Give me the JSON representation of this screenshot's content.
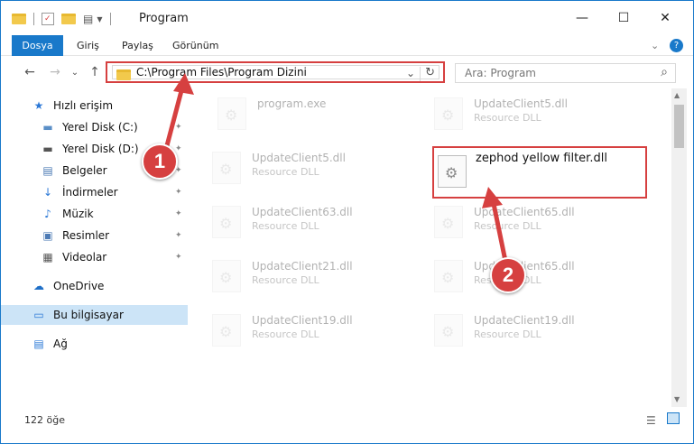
{
  "window": {
    "title": "Program",
    "controls": {
      "minimize": "—",
      "maximize": "☐",
      "close": "✕"
    }
  },
  "ribbon": {
    "tabs": [
      {
        "label": "Dosya"
      },
      {
        "label": "Giriş"
      },
      {
        "label": "Paylaş"
      },
      {
        "label": "Görünüm"
      }
    ],
    "expand_glyph": "⌄",
    "help_glyph": "?"
  },
  "navbar": {
    "back_glyph": "←",
    "forward_glyph": "→",
    "recent_glyph": "⌄",
    "up_glyph": "↑",
    "address": "C:\\Program Files\\Program Dizini",
    "dropdown_glyph": "⌄",
    "refresh_glyph": "↻",
    "search_placeholder": "Ara: Program",
    "search_glyph": "⌕"
  },
  "sidebar": {
    "items": [
      {
        "label": "Hızlı erişim",
        "icon": "star-icon",
        "glyph": "★",
        "color": "#2b78d6"
      },
      {
        "label": "Yerel Disk (C:)",
        "icon": "drive-icon",
        "glyph": "▬",
        "color": "#5a8fc7",
        "pinned": true
      },
      {
        "label": "Yerel Disk (D:)",
        "icon": "drive-icon",
        "glyph": "▬",
        "color": "#555555",
        "pinned": true
      },
      {
        "label": "Belgeler",
        "icon": "document-icon",
        "glyph": "▤",
        "color": "#4d7bb5",
        "pinned": true
      },
      {
        "label": "İndirmeler",
        "icon": "download-icon",
        "glyph": "↓",
        "color": "#2b78d6",
        "pinned": true
      },
      {
        "label": "Müzik",
        "icon": "music-icon",
        "glyph": "♪",
        "color": "#2b78d6",
        "pinned": true
      },
      {
        "label": "Resimler",
        "icon": "pictures-icon",
        "glyph": "▣",
        "color": "#4d7bb5",
        "pinned": true
      },
      {
        "label": "Videolar",
        "icon": "video-icon",
        "glyph": "▦",
        "color": "#555555",
        "pinned": true
      },
      {
        "label": "OneDrive",
        "icon": "cloud-icon",
        "glyph": "☁",
        "color": "#1f6fc7"
      },
      {
        "label": "Bu bilgisayar",
        "icon": "computer-icon",
        "glyph": "▭",
        "color": "#2b78d6",
        "selected": true
      },
      {
        "label": "Ağ",
        "icon": "network-icon",
        "glyph": "▤",
        "color": "#2b78d6"
      }
    ],
    "pin_glyph": "📌"
  },
  "files": [
    {
      "name": "program.exe",
      "desc": "",
      "faded": true
    },
    {
      "name": "UpdateClient5.dll",
      "desc": "Resource DLL",
      "faded": true
    },
    {
      "name": "UpdateClient5.dll",
      "desc": "Resource DLL",
      "faded": true
    },
    {
      "name": "zephod yellow filter.dll",
      "desc": "",
      "faded": false,
      "highlighted": true
    },
    {
      "name": "UpdateClient63.dll",
      "desc": "Resource DLL",
      "faded": true
    },
    {
      "name": "UpdateClient65.dll",
      "desc": "Resource DLL",
      "faded": true
    },
    {
      "name": "UpdateClient21.dll",
      "desc": "Resource DLL",
      "faded": true
    },
    {
      "name": "UpdateClient65.dll",
      "desc": "Resource DLL",
      "faded": true
    },
    {
      "name": "UpdateClient19.dll",
      "desc": "Resource DLL",
      "faded": true
    },
    {
      "name": "UpdateClient19.dll",
      "desc": "Resource DLL",
      "faded": true
    }
  ],
  "status": {
    "count": "122 öğe"
  },
  "annotations": {
    "step1": "1",
    "step2": "2",
    "accent": "#d64040"
  }
}
